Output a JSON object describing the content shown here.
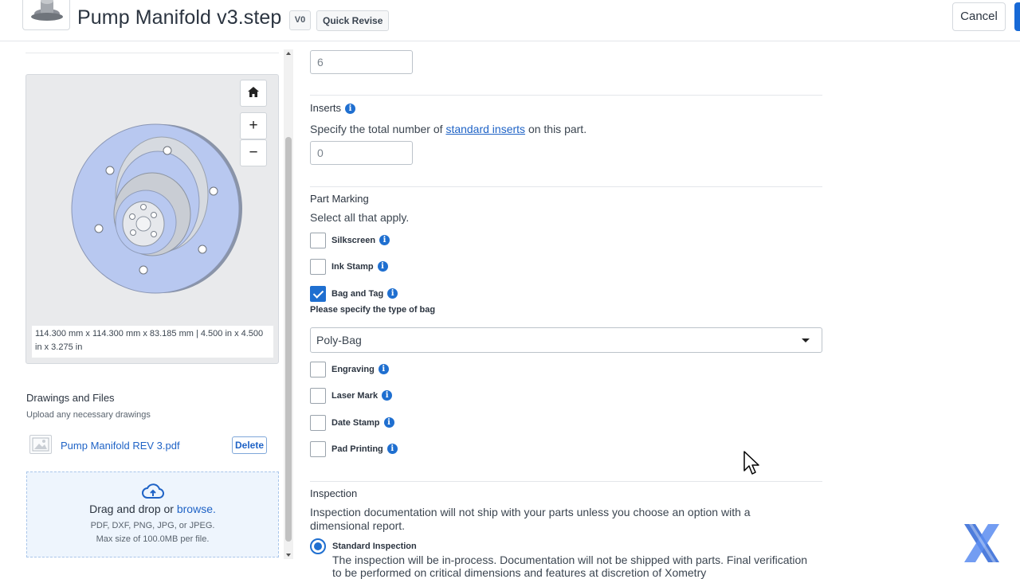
{
  "header": {
    "title": "Pump Manifold v3.step",
    "version_badge": "V0",
    "quick_revise_label": "Quick Revise",
    "cancel_label": "Cancel"
  },
  "viewer": {
    "buttons": [
      "home-icon",
      "zoom-in-icon",
      "zoom-out-icon"
    ],
    "zoom_in_glyph": "+",
    "zoom_out_glyph": "−",
    "dimensions": "114.300 mm x 114.300 mm x 83.185 mm | 4.500 in x 4.500 in x 3.275 in"
  },
  "drawings": {
    "label": "Drawings and Files",
    "hint": "Upload any necessary drawings",
    "file_name": "Pump Manifold REV 3.pdf",
    "delete_label": "Delete",
    "dropzone_text": "Drag and drop or",
    "dropzone_link": "browse.",
    "dropzone_formats": "PDF, DXF, PNG, JPG, or JPEG.",
    "dropzone_max": "Max size of 100.0MB per file."
  },
  "form": {
    "top_input_value": "6",
    "inserts": {
      "label": "Inserts",
      "desc_pre": "Specify the total number of",
      "desc_link": "standard inserts",
      "desc_post": "on this part.",
      "value": "0"
    },
    "part_marking": {
      "label": "Part Marking",
      "desc": "Select all that apply.",
      "options": [
        {
          "label": "Silkscreen",
          "checked": false
        },
        {
          "label": "Ink Stamp",
          "checked": false
        },
        {
          "label": "Bag and Tag",
          "checked": true
        },
        {
          "label": "Engraving",
          "checked": false
        },
        {
          "label": "Laser Mark",
          "checked": false
        },
        {
          "label": "Date Stamp",
          "checked": false
        },
        {
          "label": "Pad Printing",
          "checked": false
        }
      ],
      "bag_prompt": "Please specify the type of bag",
      "bag_value": "Poly-Bag"
    },
    "inspection": {
      "label": "Inspection",
      "desc": "Inspection documentation will not ship with your parts unless you choose an option with a dimensional report.",
      "standard_label": "Standard Inspection",
      "standard_desc": "The inspection will be in-process. Documentation will not be shipped with parts. Final verification to be performed on critical dimensions and features at discretion of Xometry"
    }
  },
  "colors": {
    "accent": "#1f6fd0",
    "link": "#1f63c6",
    "part_blue": "#b8c8f0"
  }
}
